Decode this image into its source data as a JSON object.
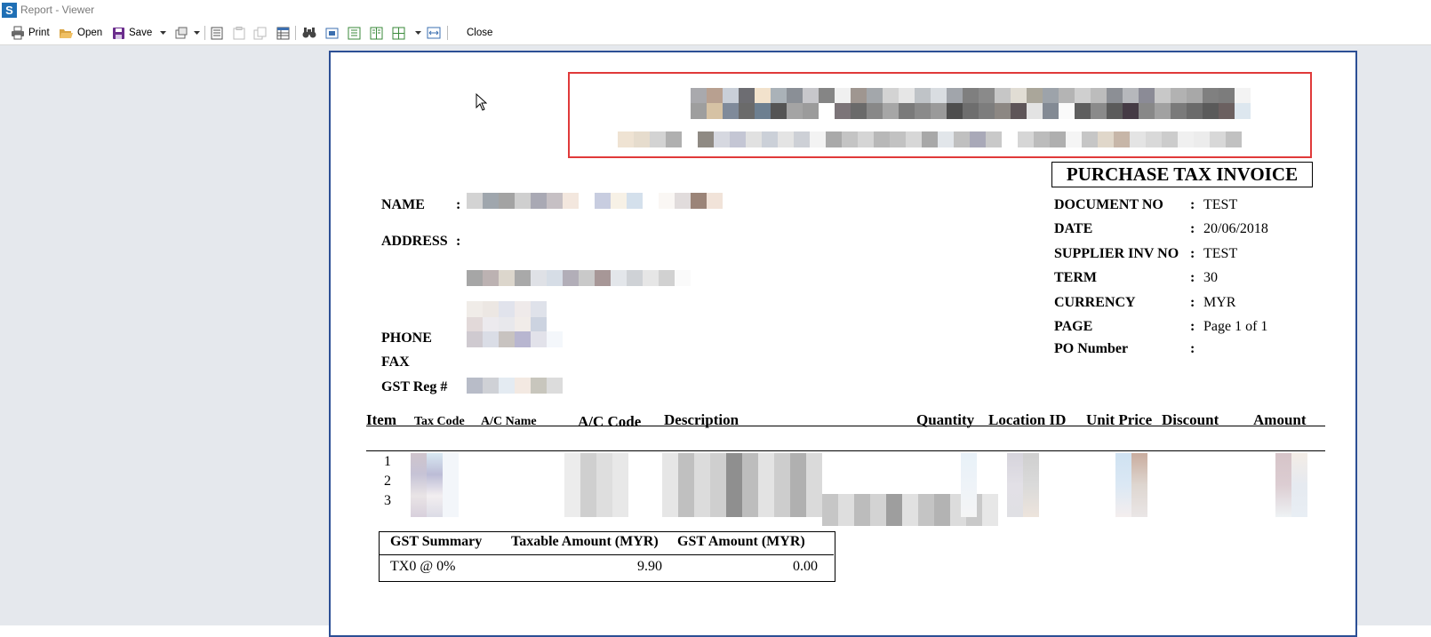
{
  "window": {
    "title": "Report - Viewer",
    "app_icon": "S"
  },
  "toolbar": {
    "print_label": "Print",
    "open_label": "Open",
    "save_label": "Save",
    "close_label": "Close"
  },
  "invoice": {
    "doc_title": "PURCHASE TAX INVOICE",
    "left_labels": {
      "name": "NAME",
      "address": "ADDRESS",
      "phone": "PHONE",
      "fax": "FAX",
      "gst_reg": "GST Reg #"
    },
    "colon": ":",
    "right_fields": [
      {
        "label": "DOCUMENT NO",
        "value": "TEST"
      },
      {
        "label": "DATE",
        "value": "20/06/2018"
      },
      {
        "label": "SUPPLIER INV NO",
        "value": "TEST"
      },
      {
        "label": "TERM",
        "value": "30"
      },
      {
        "label": "CURRENCY",
        "value": "MYR"
      },
      {
        "label": "PAGE",
        "value": "Page 1 of 1"
      },
      {
        "label": "PO Number",
        "value": ""
      }
    ],
    "columns": {
      "item": "Item",
      "tax_code": "Tax Code",
      "ac_name": "A/C Name",
      "ac_code": "A/C Code",
      "description": "Description",
      "quantity": "Quantity",
      "location_id": "Location ID",
      "unit_price": "Unit Price",
      "discount": "Discount",
      "amount": "Amount"
    },
    "rows": [
      {
        "item": "1"
      },
      {
        "item": "2"
      },
      {
        "item": "3"
      }
    ],
    "gst_summary": {
      "headers": [
        "GST Summary",
        "Taxable Amount (MYR)",
        "GST Amount (MYR)"
      ],
      "rows": [
        {
          "code": "TX0 @ 0%",
          "taxable": "9.90",
          "gst": "0.00"
        }
      ]
    }
  }
}
